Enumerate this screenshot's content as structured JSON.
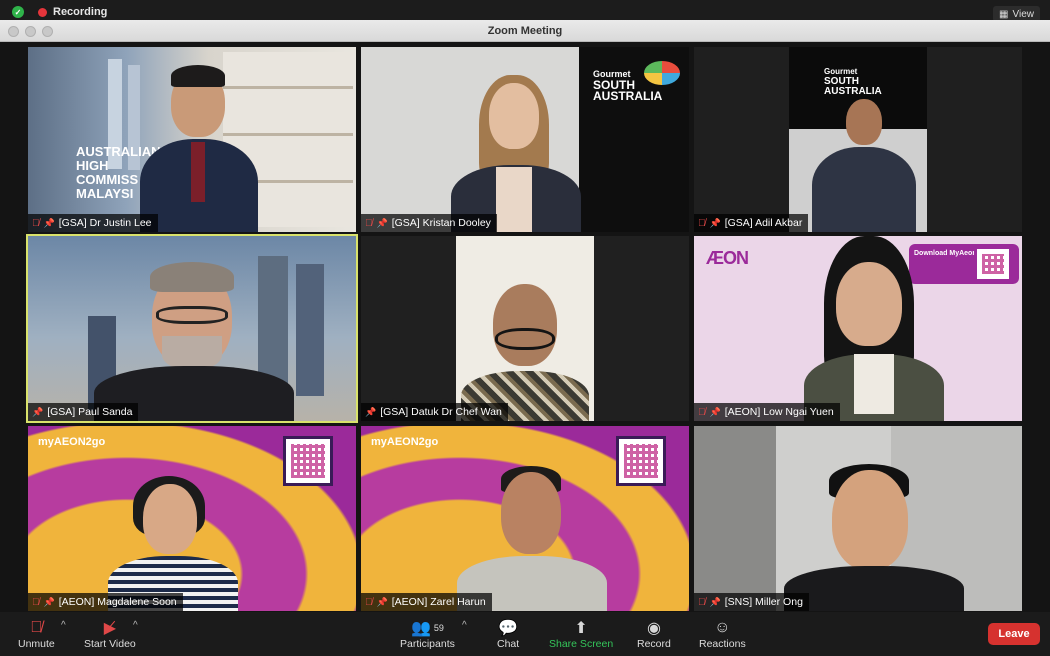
{
  "top": {
    "recording_label": "Recording",
    "view_label": "View"
  },
  "window": {
    "title": "Zoom Meeting"
  },
  "participants": [
    {
      "name": "[GSA] Dr Justin Lee",
      "muted": true,
      "backdrop_text": [
        "AUSTRALIAN",
        "HIGH",
        "COMMISS",
        "MALAYSI"
      ]
    },
    {
      "name": "[GSA] Kristan Dooley",
      "muted": true,
      "backdrop_text": [
        "Gourmet",
        "SOUTH",
        "AUSTRALIA"
      ]
    },
    {
      "name": "[GSA] Adil Akbar",
      "muted": true,
      "backdrop_text": [
        "Gourmet",
        "SOUTH",
        "AUSTRALIA"
      ]
    },
    {
      "name": "[GSA] Paul Sanda",
      "muted": false,
      "active_speaker": true
    },
    {
      "name": "[GSA] Datuk Dr Chef Wan",
      "muted": false
    },
    {
      "name": "[AEON] Low Ngai Yuen",
      "muted": true,
      "backdrop_text": [
        "ÆON",
        "Download MyAeon App"
      ]
    },
    {
      "name": "[AEON] Magdalene Soon",
      "muted": true,
      "backdrop_text": [
        "myAEON2go"
      ]
    },
    {
      "name": "[AEON] Zarel Harun",
      "muted": true,
      "backdrop_text": [
        "myAEON2go"
      ]
    },
    {
      "name": "[SNS] Miller Ong",
      "muted": true
    }
  ],
  "toolbar": {
    "unmute": "Unmute",
    "start_video": "Start Video",
    "participants": "Participants",
    "participants_count": "59",
    "chat": "Chat",
    "share_screen": "Share Screen",
    "record": "Record",
    "reactions": "Reactions",
    "leave": "Leave"
  },
  "colors": {
    "active_border": "#d9e26b",
    "share_green": "#34c55a",
    "leave_red": "#d6322f",
    "muted_red": "#e04848",
    "aeon_purple": "#9b2a9a",
    "aeon_yellow": "#f0b43c"
  }
}
